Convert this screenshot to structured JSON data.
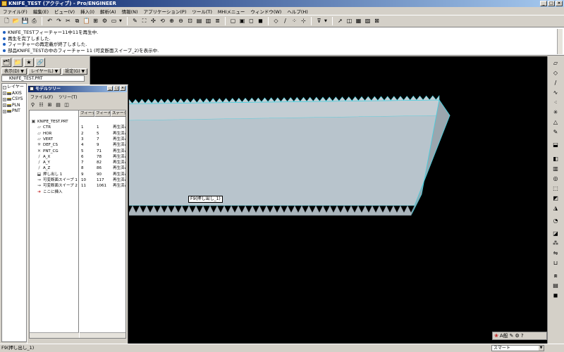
{
  "window": {
    "title": "KNIFE_TEST (アクティブ) - Pro/ENGINEER",
    "minimize": "_",
    "maximize": "□",
    "close": "×"
  },
  "menubar": {
    "items": [
      "ファイル(F)",
      "編集(E)",
      "ビュー(V)",
      "挿入(I)",
      "解析(A)",
      "情報(N)",
      "アプリケーション(P)",
      "ツール(T)",
      "MHIメニュー",
      "ウィンドウ(W)",
      "ヘルプ(H)"
    ]
  },
  "messages": [
    "KNIFE_TESTフィーチャー11中11を再生中.",
    "再生を完了しました.",
    "フィーチャーの再定義が終了しました.",
    "部品KNIFE_TESTの中のフィーチャー 11 (可変断面スイープ_2)を表示中."
  ],
  "left_panel": {
    "menus": [
      "表示(D) ▼",
      "レイヤー(L) ▼",
      "設定(G) ▼"
    ],
    "layer_model": "KNIFE_TEST.PRT",
    "layers": [
      {
        "box": "-",
        "name": "レイヤー"
      },
      {
        "box": "+",
        "name": "AXIS"
      },
      {
        "box": "+",
        "name": "CSYS"
      },
      {
        "box": "+",
        "name": "PLN"
      },
      {
        "box": "+",
        "name": "PNT"
      }
    ]
  },
  "model_tree": {
    "title": "モデルツリー",
    "menus": [
      "ファイル(F)",
      "ツリー(T)"
    ],
    "columns": [
      "フィーチャー",
      "フィーチャー",
      "ステータス"
    ],
    "rows": [
      {
        "icon": "part",
        "name": "KNIFE_TEST.PRT",
        "c1": "",
        "c2": "",
        "c3": ""
      },
      {
        "icon": "plane",
        "name": "CTR",
        "c1": "1",
        "c2": "1",
        "c3": "再生済み"
      },
      {
        "icon": "plane",
        "name": "HOR",
        "c1": "2",
        "c2": "5",
        "c3": "再生済み"
      },
      {
        "icon": "plane",
        "name": "VERT",
        "c1": "3",
        "c2": "7",
        "c3": "再生済み"
      },
      {
        "icon": "csys",
        "name": "DEF_CS",
        "c1": "4",
        "c2": "9",
        "c3": "再生済み"
      },
      {
        "icon": "point",
        "name": "PNT_CG",
        "c1": "5",
        "c2": "71",
        "c3": "再生済み"
      },
      {
        "icon": "axis",
        "name": "A_X",
        "c1": "6",
        "c2": "78",
        "c3": "再生済み"
      },
      {
        "icon": "axis",
        "name": "A_Y",
        "c1": "7",
        "c2": "82",
        "c3": "再生済み"
      },
      {
        "icon": "axis",
        "name": "A_Z",
        "c1": "8",
        "c2": "86",
        "c3": "再生済み"
      },
      {
        "icon": "extrude",
        "name": "押し出し 1",
        "c1": "9",
        "c2": "90",
        "c3": "再生済み"
      },
      {
        "icon": "sweep",
        "name": "可変断面スイープ 1",
        "c1": "10",
        "c2": "117",
        "c3": "再生済み"
      },
      {
        "icon": "sweep",
        "name": "可変断面スイープ 2",
        "c1": "11",
        "c2": "1061",
        "c3": "再生済み"
      },
      {
        "icon": "insert",
        "name": "ここに挿入",
        "c1": "",
        "c2": "",
        "c3": ""
      }
    ]
  },
  "viewport": {
    "tooltip": "F9(押し出し_1)",
    "colors": {
      "background": "#000000",
      "part_fill": "#b8c4cc",
      "part_side": "#9aa6ae",
      "edge_highlight": "#40d0e0"
    }
  },
  "status": {
    "text": "F9(押し出し_1)",
    "filter": "スマート"
  },
  "ime": {
    "mode": "A般"
  }
}
